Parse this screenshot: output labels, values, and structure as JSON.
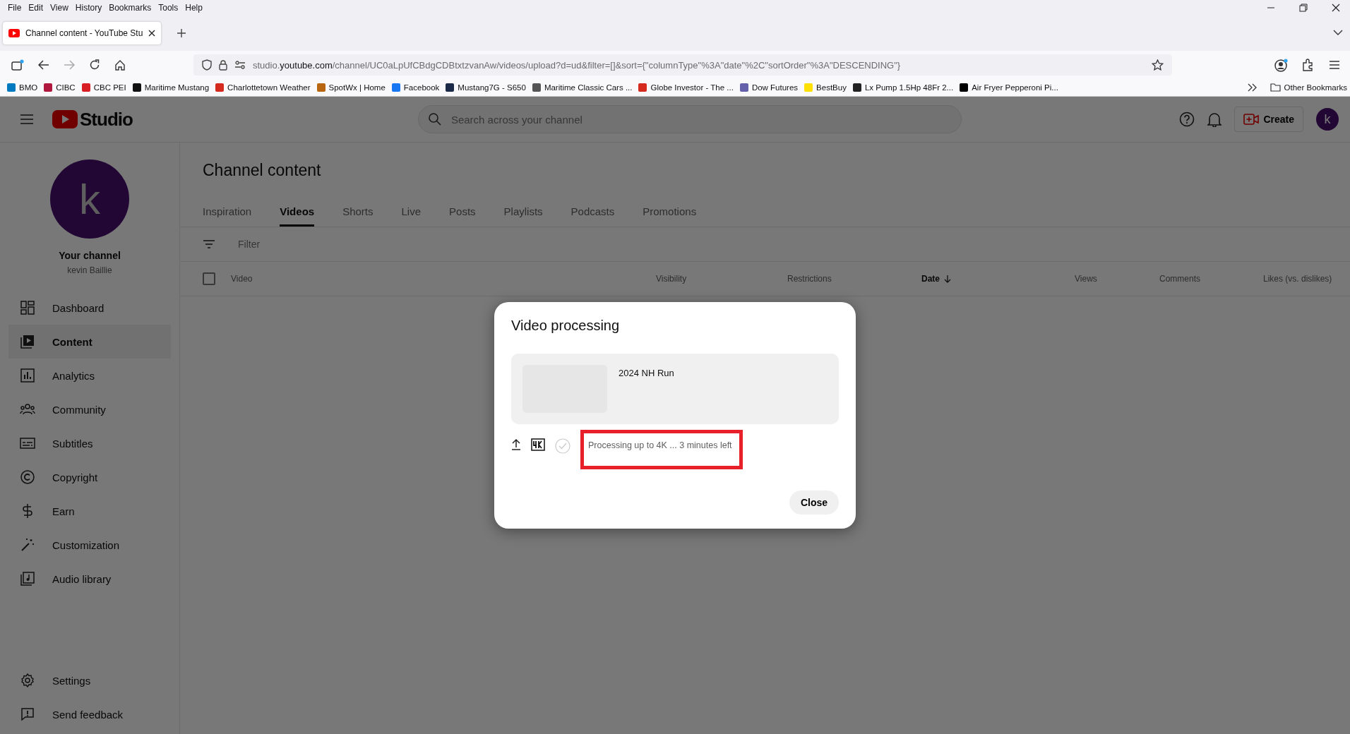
{
  "menu_bar": [
    "File",
    "Edit",
    "View",
    "History",
    "Bookmarks",
    "Tools",
    "Help"
  ],
  "tabs": [
    {
      "title": "Channel content - YouTube Stu",
      "selected": true
    }
  ],
  "address": {
    "prefix": "studio.",
    "domain": "youtube.com",
    "path": "/channel/UC0aLpUfCBdgCDBtxtzvanAw/videos/upload?d=ud&filter=[]&sort={\"columnType\"%3A\"date\"%2C\"sortOrder\"%3A\"DESCENDING\"}"
  },
  "bookmarks": [
    {
      "label": "BMO",
      "color": "#0079c1"
    },
    {
      "label": "CIBC",
      "color": "#b0193d"
    },
    {
      "label": "CBC PEI",
      "color": "#d91f26"
    },
    {
      "label": "Maritime Mustang",
      "color": "#111111"
    },
    {
      "label": "Charlottetown Weather",
      "color": "#d52b1e"
    },
    {
      "label": "SpotWx | Home",
      "color": "#b8660f"
    },
    {
      "label": "Facebook",
      "color": "#1877f2"
    },
    {
      "label": "Mustang7G - S650",
      "color": "#1c2a4a"
    },
    {
      "label": "Maritime Classic Cars ...",
      "color": "#555555"
    },
    {
      "label": "Globe Investor - The ...",
      "color": "#d52b1e"
    },
    {
      "label": "Dow Futures",
      "color": "#6460aa"
    },
    {
      "label": "BestBuy",
      "color": "#ffe000"
    },
    {
      "label": "Lx Pump 1.5Hp 48Fr 2...",
      "color": "#222222"
    },
    {
      "label": "Air Fryer Pepperoni Pi...",
      "color": "#000000"
    }
  ],
  "other_bookmarks": "Other Bookmarks",
  "studio": {
    "logo": "Studio",
    "search_placeholder": "Search across your channel",
    "create": "Create",
    "avatar": "k"
  },
  "sidebar": {
    "avatar": "k",
    "title": "Your channel",
    "name": "kevin Baillie",
    "items": [
      {
        "kind": "dashboard",
        "label": "Dashboard",
        "selected": false
      },
      {
        "kind": "content",
        "label": "Content",
        "selected": true
      },
      {
        "kind": "analytics",
        "label": "Analytics",
        "selected": false
      },
      {
        "kind": "community",
        "label": "Community",
        "selected": false
      },
      {
        "kind": "subtitles",
        "label": "Subtitles",
        "selected": false
      },
      {
        "kind": "copyright",
        "label": "Copyright",
        "selected": false
      },
      {
        "kind": "earn",
        "label": "Earn",
        "selected": false
      },
      {
        "kind": "customization",
        "label": "Customization",
        "selected": false
      },
      {
        "kind": "audio",
        "label": "Audio library",
        "selected": false
      }
    ],
    "bottom_items": [
      {
        "kind": "settings",
        "label": "Settings"
      },
      {
        "kind": "feedback",
        "label": "Send feedback"
      }
    ]
  },
  "page_title": "Channel content",
  "content_tabs": [
    {
      "label": "Inspiration",
      "selected": false
    },
    {
      "label": "Videos",
      "selected": true
    },
    {
      "label": "Shorts",
      "selected": false
    },
    {
      "label": "Live",
      "selected": false
    },
    {
      "label": "Posts",
      "selected": false
    },
    {
      "label": "Playlists",
      "selected": false
    },
    {
      "label": "Podcasts",
      "selected": false
    },
    {
      "label": "Promotions",
      "selected": false
    }
  ],
  "filter_placeholder": "Filter",
  "select_all_checked": false,
  "columns": [
    {
      "label": "Video",
      "sorted": false
    },
    {
      "label": "Visibility",
      "sorted": false
    },
    {
      "label": "Restrictions",
      "sorted": false
    },
    {
      "label": "Date",
      "sorted": true
    },
    {
      "label": "Views",
      "sorted": false
    },
    {
      "label": "Comments",
      "sorted": false
    },
    {
      "label": "Likes (vs. dislikes)",
      "sorted": false
    }
  ],
  "dialog": {
    "title": "Video processing",
    "video_title": "2024 NH Run",
    "status": "Processing up to 4K ... 3 minutes left",
    "highlighted": true,
    "close": "Close"
  }
}
